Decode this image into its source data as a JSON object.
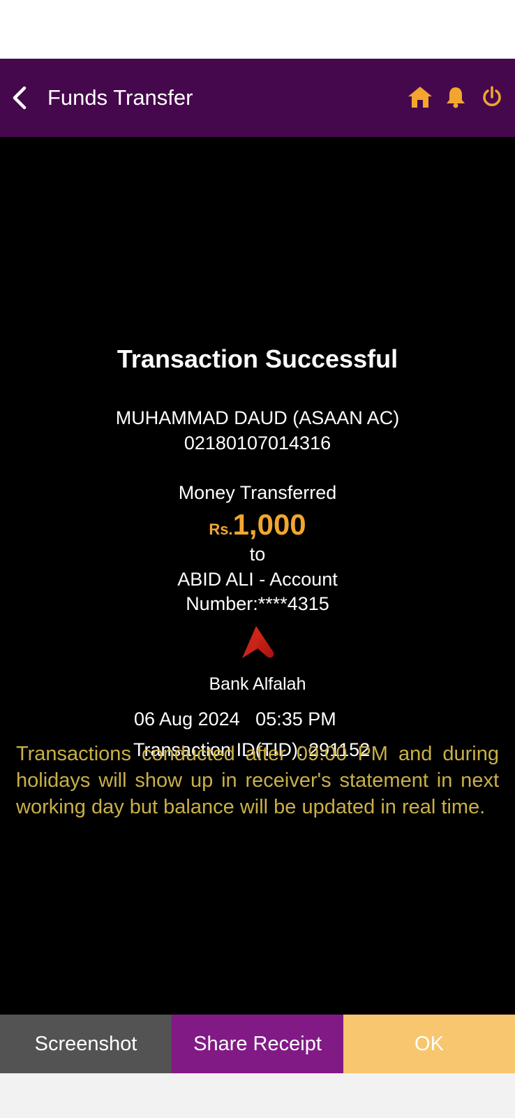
{
  "header": {
    "title": "Funds Transfer",
    "back_icon": "chevron-left-icon",
    "home_icon": "home-icon",
    "bell_icon": "bell-icon",
    "power_icon": "power-icon"
  },
  "receipt": {
    "title": "Transaction Successful",
    "sender_name": "MUHAMMAD DAUD (ASAAN AC)",
    "sender_account": "02180107014316",
    "money_label": "Money Transferred",
    "currency": "Rs.",
    "amount": "1,000",
    "to_label": "to",
    "recipient_line1": "ABID ALI  - Account",
    "recipient_line2": "Number:****4315",
    "bank_logo_icon": "bank-alfalah-logo",
    "bank_name": "Bank Alfalah",
    "date": "06 Aug 2024",
    "time": "05:35 PM",
    "tid_label": "Transaction ID(TID):",
    "tid_value": "291152"
  },
  "notice": "Transactions conducted after 09:00 PM and during holidays will show up in receiver's statement in next working day but balance will be updated in real time.",
  "actions": {
    "screenshot_label": "Screenshot",
    "share_label": "Share Receipt",
    "ok_label": "OK"
  },
  "colors": {
    "header_bg": "#46084d",
    "accent": "#f2a630",
    "notice_text": "#c9b047",
    "screenshot_bg": "#535353",
    "share_bg": "#821a86",
    "ok_bg": "#f7c66f"
  }
}
